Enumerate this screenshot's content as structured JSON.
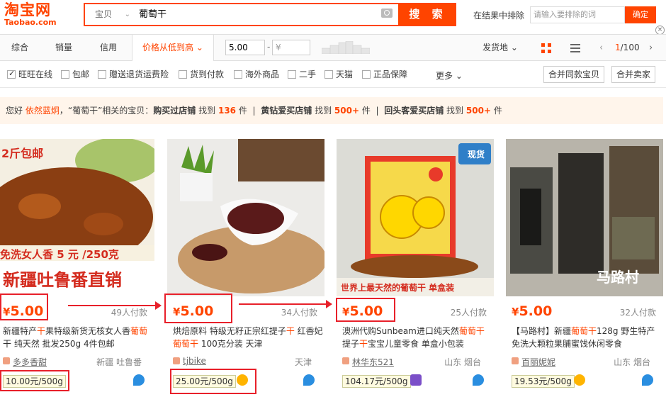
{
  "logo": {
    "cn": "淘宝网",
    "en": "Taobao.com"
  },
  "search": {
    "scope": "宝贝",
    "query": "葡萄干",
    "button": "搜 索"
  },
  "exclude": {
    "label": "在结果中排除",
    "placeholder": "请输入要排除的词",
    "confirm": "确定"
  },
  "sort": {
    "tabs": [
      "综合",
      "销量",
      "信用"
    ],
    "active_tab": "价格从低到高",
    "price_from": "5.00",
    "price_to": "¥",
    "ship_from": "发货地",
    "page_current": "1",
    "page_total": "/100"
  },
  "filters": [
    {
      "label": "旺旺在线",
      "checked": true
    },
    {
      "label": "包邮",
      "checked": false
    },
    {
      "label": "赠送退货运费险",
      "checked": false
    },
    {
      "label": "货到付款",
      "checked": false
    },
    {
      "label": "海外商品",
      "checked": false
    },
    {
      "label": "二手",
      "checked": false
    },
    {
      "label": "天猫",
      "checked": false
    },
    {
      "label": "正品保障",
      "checked": false
    }
  ],
  "filters_more": "更多",
  "merge_buttons": [
    "合并同款宝贝",
    "合并卖家"
  ],
  "notice": {
    "prefix": "您好",
    "user": "依然蓝炯",
    "mid": "，“葡萄干”相关的宝贝：",
    "seg1_label": "购买过店铺",
    "seg1_pre": "找到",
    "seg1_num": "136",
    "seg1_unit": "件",
    "sep": "|",
    "seg2_label": "黄钻爱买店铺",
    "seg2_pre": "找到",
    "seg2_num": "500+",
    "seg2_unit": "件",
    "seg3_label": "回头客爱买店铺",
    "seg3_pre": "找到",
    "seg3_num": "500+",
    "seg3_unit": "件"
  },
  "products": [
    {
      "price_symbol": "¥",
      "price": "5.00",
      "paid": "49人付款",
      "title_parts": [
        "新疆特产",
        "干",
        "果特级新货无核女人香",
        "葡萄",
        "干 纯天然 批发250g 4件包邮"
      ],
      "shop": "多多香甜",
      "location": "新疆 吐鲁番",
      "unit_price": "10.00元/500g",
      "img_text_top": "2斤包邮",
      "img_text_mid": "免洗女人香 5 元 /250克",
      "img_text_bottom": "新疆吐鲁番直销"
    },
    {
      "price_symbol": "¥",
      "price": "5.00",
      "paid": "34人付款",
      "title_parts": [
        "烘焙原料 特级无籽正宗红提子",
        "干",
        " 红香妃",
        "葡萄干",
        " 100克分装 天津"
      ],
      "shop": "tjbike",
      "location": "天津",
      "unit_price": "25.00元/500g",
      "img_text_top": "",
      "img_text_mid": "",
      "img_text_bottom": ""
    },
    {
      "price_symbol": "¥",
      "price": "5.00",
      "paid": "25人付款",
      "title_parts": [
        "澳洲代购Sunbeam进口纯天然",
        "葡萄干",
        " 提子",
        "干",
        "宝宝儿童零食 单盒小包装"
      ],
      "shop": "林华东521",
      "location": "山东 烟台",
      "unit_price": "104.17元/500g",
      "img_text_top": "现货",
      "img_text_mid": "",
      "img_text_bottom": "世界上最天然的葡萄干 单盒装"
    },
    {
      "price_symbol": "¥",
      "price": "5.00",
      "paid": "32人付款",
      "title_parts": [
        "【马路村】新疆",
        "葡萄干",
        "128g 野生特产免洗大颗粒果脯蜜饯休闲零食",
        "",
        ""
      ],
      "shop": "百丽妮妮",
      "location": "山东 烟台",
      "unit_price": "19.53元/500g",
      "img_text_top": "",
      "img_text_mid": "",
      "img_text_bottom": "马路村"
    }
  ],
  "colors": {
    "accent": "#ff4400",
    "annotation": "#e8202a"
  }
}
